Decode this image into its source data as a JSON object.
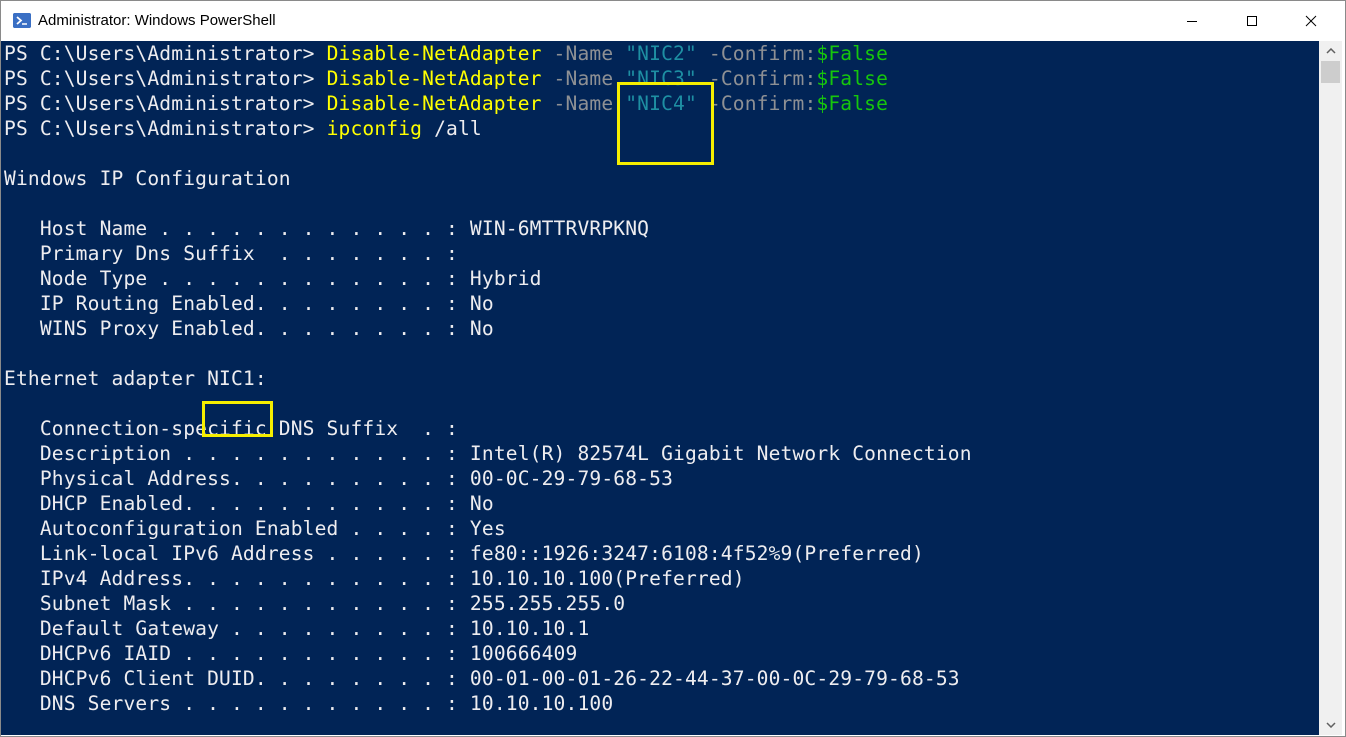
{
  "window": {
    "title": "Administrator: Windows PowerShell",
    "controls": {
      "minimize": "minimize",
      "maximize": "maximize",
      "close": "close"
    }
  },
  "colors": {
    "console_bg": "#012456",
    "prompt": "#eeedf0",
    "cmdlet": "#ffff00",
    "parameter": "#8e9094",
    "string": "#1e8fa3",
    "variable": "#16c60c",
    "highlight_box": "#f5ee00"
  },
  "commands": [
    {
      "prompt": "PS C:\\Users\\Administrator> ",
      "cmdlet": "Disable-NetAdapter",
      "param1": " -Name ",
      "value": "\"NIC2\"",
      "param2": " -Confirm:",
      "variable": "$False"
    },
    {
      "prompt": "PS C:\\Users\\Administrator> ",
      "cmdlet": "Disable-NetAdapter",
      "param1": " -Name ",
      "value": "\"NIC3\"",
      "param2": " -Confirm:",
      "variable": "$False"
    },
    {
      "prompt": "PS C:\\Users\\Administrator> ",
      "cmdlet": "Disable-NetAdapter",
      "param1": " -Name ",
      "value": "\"NIC4\"",
      "param2": " -Confirm:",
      "variable": "$False"
    },
    {
      "prompt": "PS C:\\Users\\Administrator> ",
      "cmdlet": "ipconfig",
      "args": " /all"
    }
  ],
  "output": {
    "heading": "Windows IP Configuration",
    "global": [
      {
        "label": "   Host Name . . . . . . . . . . . . : ",
        "value": "WIN-6MTTRVRPKNQ"
      },
      {
        "label": "   Primary Dns Suffix  . . . . . . . : ",
        "value": ""
      },
      {
        "label": "   Node Type . . . . . . . . . . . . : ",
        "value": "Hybrid"
      },
      {
        "label": "   IP Routing Enabled. . . . . . . . : ",
        "value": "No"
      },
      {
        "label": "   WINS Proxy Enabled. . . . . . . . : ",
        "value": "No"
      }
    ],
    "adapter_prefix": "Ethernet adapter ",
    "adapter_name": "NIC1:",
    "adapter": [
      {
        "label": "   Connection-specific DNS Suffix  . : ",
        "value": ""
      },
      {
        "label": "   Description . . . . . . . . . . . : ",
        "value": "Intel(R) 82574L Gigabit Network Connection"
      },
      {
        "label": "   Physical Address. . . . . . . . . : ",
        "value": "00-0C-29-79-68-53"
      },
      {
        "label": "   DHCP Enabled. . . . . . . . . . . : ",
        "value": "No"
      },
      {
        "label": "   Autoconfiguration Enabled . . . . : ",
        "value": "Yes"
      },
      {
        "label": "   Link-local IPv6 Address . . . . . : ",
        "value": "fe80::1926:3247:6108:4f52%9(Preferred)"
      },
      {
        "label": "   IPv4 Address. . . . . . . . . . . : ",
        "value": "10.10.10.100(Preferred)"
      },
      {
        "label": "   Subnet Mask . . . . . . . . . . . : ",
        "value": "255.255.255.0"
      },
      {
        "label": "   Default Gateway . . . . . . . . . : ",
        "value": "10.10.10.1"
      },
      {
        "label": "   DHCPv6 IAID . . . . . . . . . . . : ",
        "value": "100666409"
      },
      {
        "label": "   DHCPv6 Client DUID. . . . . . . . : ",
        "value": "00-01-00-01-26-22-44-37-00-0C-29-79-68-53"
      },
      {
        "label": "   DNS Servers . . . . . . . . . . . : ",
        "value": "10.10.10.100"
      }
    ]
  }
}
